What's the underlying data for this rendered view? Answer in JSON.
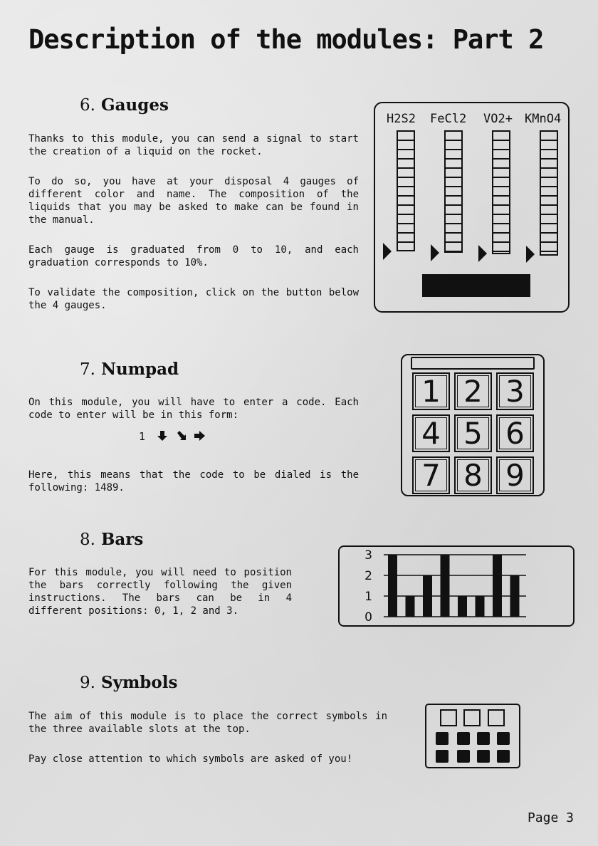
{
  "title": "Description of the modules: Part 2",
  "sections": {
    "gauges": {
      "num": "6.",
      "heading": "Gauges",
      "paragraphs": [
        "Thanks to this module, you can send a signal to start the creation of a liquid on the rocket.",
        "To do so, you have at your disposal 4 gauges of different color and name. The composition of the liquids that you may be asked to make can be found in the manual.",
        "Each gauge is graduated from 0 to 10, and each graduation corresponds to 10%.",
        "To validate the composition, click on the button below the 4 gauges."
      ],
      "labels": [
        "H2S2",
        "FeCl2",
        "VO2+",
        "KMnO4"
      ]
    },
    "numpad": {
      "num": "7.",
      "heading": "Numpad",
      "paragraphs": [
        "On this module, you will have to enter a code. Each code to enter will be in this form:",
        "Here, this means that the code to be dialed is the following: 1489."
      ],
      "example_digit": "1",
      "example_arrows": [
        "down-arrow-icon",
        "down-right-arrow-icon",
        "right-arrow-icon"
      ],
      "keys": [
        "1",
        "2",
        "3",
        "4",
        "5",
        "6",
        "7",
        "8",
        "9"
      ]
    },
    "bars": {
      "num": "8.",
      "heading": "Bars",
      "paragraphs": [
        "For this module, you will need to position the bars correctly following the given instructions. The bars can be in 4 different positions: 0, 1, 2 and 3."
      ],
      "axis_ticks": [
        "0",
        "1",
        "2",
        "3"
      ],
      "bar_values": [
        3,
        1,
        2,
        3,
        1,
        1,
        3,
        2
      ]
    },
    "symbols": {
      "num": "9.",
      "heading": "Symbols",
      "paragraphs": [
        "The aim of this module is to place the correct symbols in the three available slots at the top.",
        "Pay close attention to which symbols are asked of you!"
      ]
    }
  },
  "page_label": "Page 3"
}
